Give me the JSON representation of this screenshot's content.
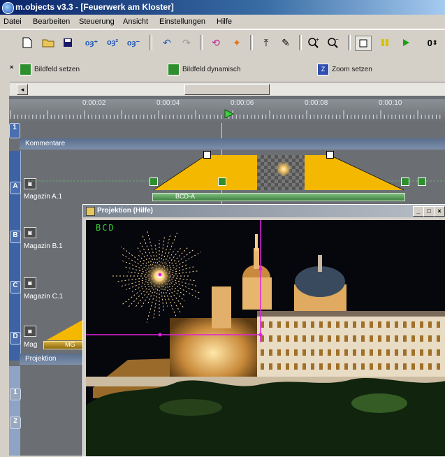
{
  "window": {
    "title": "m.objects v3.3 - [Feuerwerk am Kloster]"
  },
  "menu": [
    "Datei",
    "Bearbeiten",
    "Steuerung",
    "Ansicht",
    "Einstellungen",
    "Hilfe"
  ],
  "toolbar": {
    "icons": [
      "new-document-icon",
      "open-folder-icon",
      "save-icon",
      "objects-add-icon",
      "objects-edit-icon",
      "objects-remove-icon",
      "undo-icon",
      "redo-icon",
      "refresh-icon",
      "transition-icon",
      "lift-icon",
      "pen-icon",
      "zoom-in-icon",
      "zoom-out-icon",
      "stop-icon",
      "pause-icon",
      "play-icon"
    ],
    "counter": "0"
  },
  "actions": [
    {
      "label": "Bildfeld setzen",
      "color": "#2f8f2f"
    },
    {
      "label": "Bildfeld dynamisch",
      "color": "#2f8f2f"
    },
    {
      "label": "Zoom setzen",
      "color": "#2f4fb0"
    }
  ],
  "ruler": {
    "ticks": [
      "0:00:02",
      "0:00:04",
      "0:00:06",
      "0:00:08",
      "0:00:10"
    ]
  },
  "tracks": {
    "kommentare_label": "Kommentare",
    "track1_num": "1",
    "a_letter": "A",
    "a_label": "Magazin A.1",
    "a_clip": "BCD-A",
    "b_letter": "B",
    "b_label": "Magazin B.1",
    "c_letter": "C",
    "c_label": "Magazin C.1",
    "d_letter": "D",
    "d_label": "Mag",
    "d_clip": "MG",
    "projektion_label": "Projektion",
    "p1_num": "1",
    "p2_num": "2"
  },
  "projection": {
    "title": "Projektion (Hilfe)",
    "overlay_text": "BCD",
    "buttons": [
      "_",
      "□",
      "×"
    ]
  },
  "colors": {
    "accent_yellow": "#f5b800",
    "crosshair": "#e020e0",
    "track_bg": "#6b6f74"
  }
}
